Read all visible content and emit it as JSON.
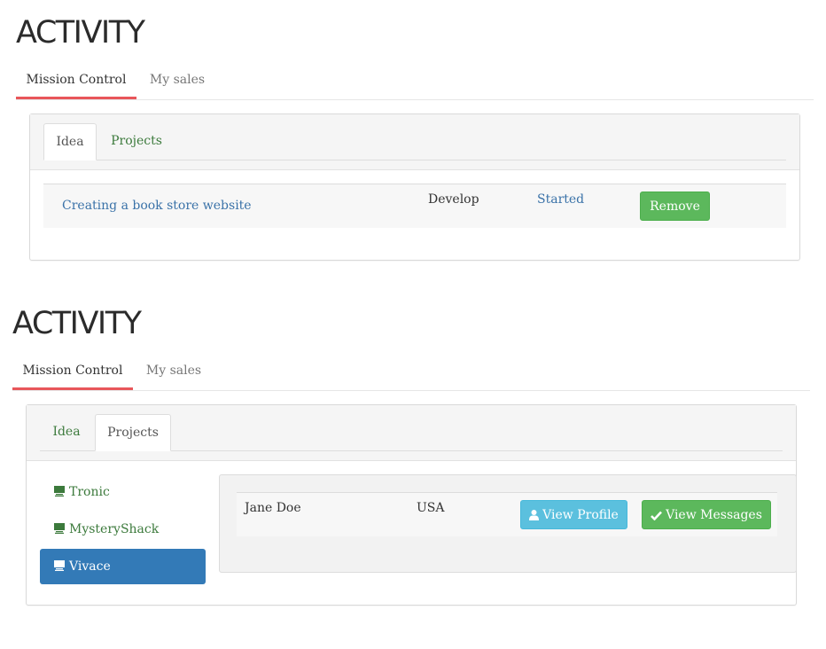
{
  "section1": {
    "title": "ACTIVITY",
    "top_tabs": [
      "Mission Control",
      "My sales"
    ],
    "inner_tabs": [
      "Idea",
      "Projects"
    ],
    "row": {
      "name": "Creating a book store website",
      "type": "Develop",
      "status": "Started",
      "remove_label": "Remove"
    }
  },
  "section2": {
    "title": "ACTIVITY",
    "top_tabs": [
      "Mission Control",
      "My sales"
    ],
    "inner_tabs": [
      "Idea",
      "Projects"
    ],
    "projects": [
      "Tronic",
      "MysteryShack",
      "Vivace"
    ],
    "row": {
      "name": "Jane Doe",
      "country": "USA",
      "view_profile_label": "View Profile",
      "view_messages_label": "View Messages"
    }
  },
  "colors": {
    "accent_underline": "#e8565a",
    "link_green": "#3c7a3c",
    "link_blue": "#3a72a8",
    "button_green": "#5cb85c",
    "button_blue": "#5bc0de",
    "active_item": "#337ab7"
  },
  "icons": {
    "project_item": "monitor-icon",
    "view_profile": "user-icon",
    "view_messages": "check-icon"
  }
}
